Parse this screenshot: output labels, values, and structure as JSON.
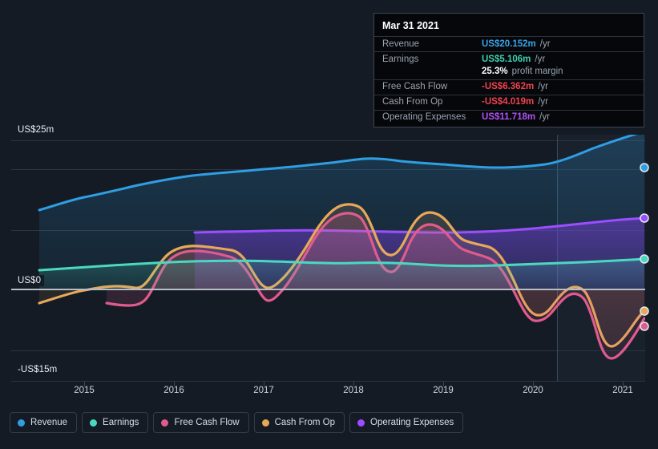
{
  "chart_data": {
    "type": "area",
    "title": "",
    "xlabel": "",
    "ylabel": "",
    "currency": "US$",
    "xlim": [
      2014.55,
      2021.45
    ],
    "ylim": [
      -15,
      25
    ],
    "y_ticks": [
      25,
      20,
      10,
      0,
      -10,
      -15
    ],
    "y_tick_labels": [
      "US$25m",
      "",
      "",
      "US$0",
      "",
      "-US$15m"
    ],
    "x_ticks": [
      2015,
      2016,
      2017,
      2018,
      2019,
      2020,
      2021
    ],
    "x_tick_labels": [
      "2015",
      "2016",
      "2017",
      "2018",
      "2019",
      "2020",
      "2021"
    ],
    "grid": true,
    "legend_position": "bottom",
    "forecast_start": 2020.35,
    "series": [
      {
        "name": "Revenue",
        "color": "#2f9fe3",
        "final_value": 20.152,
        "x": [
          2014.75,
          2015.0,
          2015.3,
          2015.6,
          2016.0,
          2016.35,
          2016.7,
          2017.0,
          2017.3,
          2017.6,
          2018.0,
          2018.25,
          2018.5,
          2018.75,
          2019.0,
          2019.3,
          2019.6,
          2020.0,
          2020.35,
          2020.6,
          2020.9,
          2021.25
        ],
        "values": [
          13.2,
          13.9,
          14.5,
          15.0,
          15.6,
          16.1,
          16.4,
          16.6,
          16.9,
          17.2,
          17.6,
          17.4,
          17.3,
          17.5,
          17.4,
          17.2,
          17.1,
          17.3,
          17.6,
          18.4,
          19.5,
          20.152
        ]
      },
      {
        "name": "Earnings",
        "color": "#4ad9c0",
        "final_value": 5.106,
        "x": [
          2014.75,
          2015.2,
          2015.7,
          2016.1,
          2016.5,
          2017.0,
          2017.5,
          2018.0,
          2018.4,
          2018.8,
          2019.2,
          2019.6,
          2020.0,
          2020.4,
          2020.8,
          2021.25
        ],
        "values": [
          3.2,
          3.4,
          3.6,
          3.9,
          3.9,
          3.7,
          3.6,
          3.8,
          3.5,
          3.6,
          3.9,
          4.2,
          4.3,
          4.4,
          4.7,
          5.106
        ]
      },
      {
        "name": "Free Cash Flow",
        "color": "#e05b8d",
        "final_value": -6.362,
        "x": [
          2015.45,
          2015.8,
          2016.0,
          2016.25,
          2016.6,
          2017.0,
          2017.2,
          2017.45,
          2017.7,
          2018.0,
          2018.2,
          2018.45,
          2018.7,
          2019.0,
          2019.25,
          2019.5,
          2019.8,
          2020.05,
          2020.3,
          2020.6,
          2020.9,
          2021.1,
          2021.25
        ],
        "values": [
          -2.3,
          -2.4,
          -0.4,
          5.0,
          6.3,
          6.2,
          -1.8,
          -0.6,
          2.4,
          11.9,
          12.2,
          2.0,
          10.9,
          6.4,
          7.6,
          0.1,
          -5.5,
          -6.2,
          -1.2,
          -1.8,
          -10.5,
          -8.1,
          -6.362
        ]
      },
      {
        "name": "Cash From Op",
        "color": "#e8a85a",
        "final_value": -4.019,
        "x": [
          2014.75,
          2015.1,
          2015.45,
          2015.75,
          2016.0,
          2016.25,
          2016.6,
          2017.0,
          2017.2,
          2017.45,
          2017.7,
          2018.0,
          2018.2,
          2018.45,
          2018.7,
          2019.0,
          2019.25,
          2019.5,
          2019.8,
          2020.05,
          2020.3,
          2020.6,
          2020.9,
          2021.1,
          2021.25
        ],
        "values": [
          -2.3,
          -1.4,
          -0.2,
          0.5,
          0.2,
          5.8,
          7.1,
          7.0,
          -0.4,
          1.0,
          3.5,
          13.9,
          14.0,
          5.7,
          12.8,
          8.3,
          9.2,
          1.5,
          -3.7,
          -4.3,
          0.4,
          -0.5,
          -9.5,
          -6.4,
          -4.019
        ]
      },
      {
        "name": "Operating Expenses",
        "color": "#9b4dff",
        "final_value": 11.718,
        "x": [
          2015.85,
          2016.3,
          2016.8,
          2017.3,
          2017.8,
          2018.3,
          2018.8,
          2019.3,
          2019.8,
          2020.3,
          2020.8,
          2021.25
        ],
        "values": [
          9.4,
          9.5,
          9.5,
          9.6,
          9.6,
          9.5,
          9.4,
          9.6,
          10.0,
          10.5,
          11.1,
          11.718
        ]
      }
    ]
  },
  "tooltip": {
    "title": "Mar 31 2021",
    "rows": [
      {
        "label": "Revenue",
        "value": "US$20.152m",
        "unit": "/yr",
        "color_key": "c-rev"
      },
      {
        "label": "Earnings",
        "value": "US$5.106m",
        "unit": "/yr",
        "color_key": "c-ear"
      },
      {
        "label": "",
        "value": "25.3%",
        "unit": "profit margin",
        "color_key": "c-white"
      },
      {
        "label": "Free Cash Flow",
        "value": "-US$6.362m",
        "unit": "/yr",
        "color_key": "c-neg"
      },
      {
        "label": "Cash From Op",
        "value": "-US$4.019m",
        "unit": "/yr",
        "color_key": "c-neg"
      },
      {
        "label": "Operating Expenses",
        "value": "US$11.718m",
        "unit": "/yr",
        "color_key": "c-opx"
      }
    ]
  },
  "axis": {
    "y_top": "US$25m",
    "y_zero": "US$0",
    "y_bottom": "-US$15m",
    "x_labels": [
      "2015",
      "2016",
      "2017",
      "2018",
      "2019",
      "2020",
      "2021"
    ]
  },
  "legend": {
    "items": [
      {
        "label": "Revenue",
        "color": "#2f9fe3"
      },
      {
        "label": "Earnings",
        "color": "#4ad9c0"
      },
      {
        "label": "Free Cash Flow",
        "color": "#e05b8d"
      },
      {
        "label": "Cash From Op",
        "color": "#e8a85a"
      },
      {
        "label": "Operating Expenses",
        "color": "#9b4dff"
      }
    ]
  }
}
